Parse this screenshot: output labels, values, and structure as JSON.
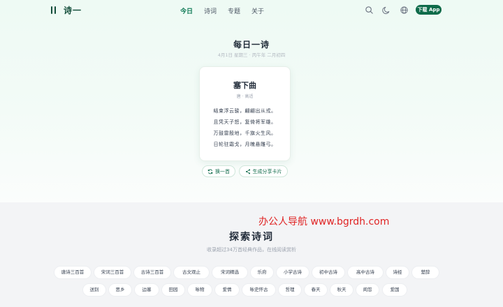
{
  "header": {
    "logo": "诗一",
    "nav": [
      {
        "label": "今日",
        "active": true
      },
      {
        "label": "诗词",
        "active": false
      },
      {
        "label": "专题",
        "active": false
      },
      {
        "label": "关于",
        "active": false
      }
    ],
    "icons": [
      "search-icon",
      "moon-icon",
      "globe-icon"
    ],
    "download_label": "下载 App"
  },
  "daily": {
    "title": "每日一诗",
    "date": "4月1日 星期三 · 丙午年 二月初四",
    "poem": {
      "title": "塞下曲",
      "author": "唐 · 高适",
      "lines": [
        "结束浮云骏，翩翩出从戎。",
        "且凭天子怒，复倚将军雄。",
        "万鼓雷殷地，千旗火生风。",
        "日轮驻霜戈，月魄悬雕弓。"
      ]
    },
    "actions": {
      "refresh": "换一首",
      "share": "生成分享卡片"
    }
  },
  "watermark": "办公人导航 www.bgrdh.com",
  "explore": {
    "title": "探索诗词",
    "subtitle": "收录超过34万首经典作品，在线阅读赏析",
    "tags_row1": [
      "唐诗三百首",
      "宋词三百首",
      "古诗三百首",
      "古文观止",
      "宋词精选",
      "乐府",
      "小学古诗",
      "初中古诗",
      "高中古诗",
      "诗经",
      "楚辞"
    ],
    "tags_row2": [
      "送别",
      "思乡",
      "边塞",
      "田园",
      "咏物",
      "爱情",
      "咏史怀古",
      "哲理",
      "春天",
      "秋天",
      "闺怨",
      "爱国"
    ]
  },
  "colors": {
    "brand": "#0f6b4a",
    "accent": "#0f7a55",
    "watermark": "#e02424"
  }
}
